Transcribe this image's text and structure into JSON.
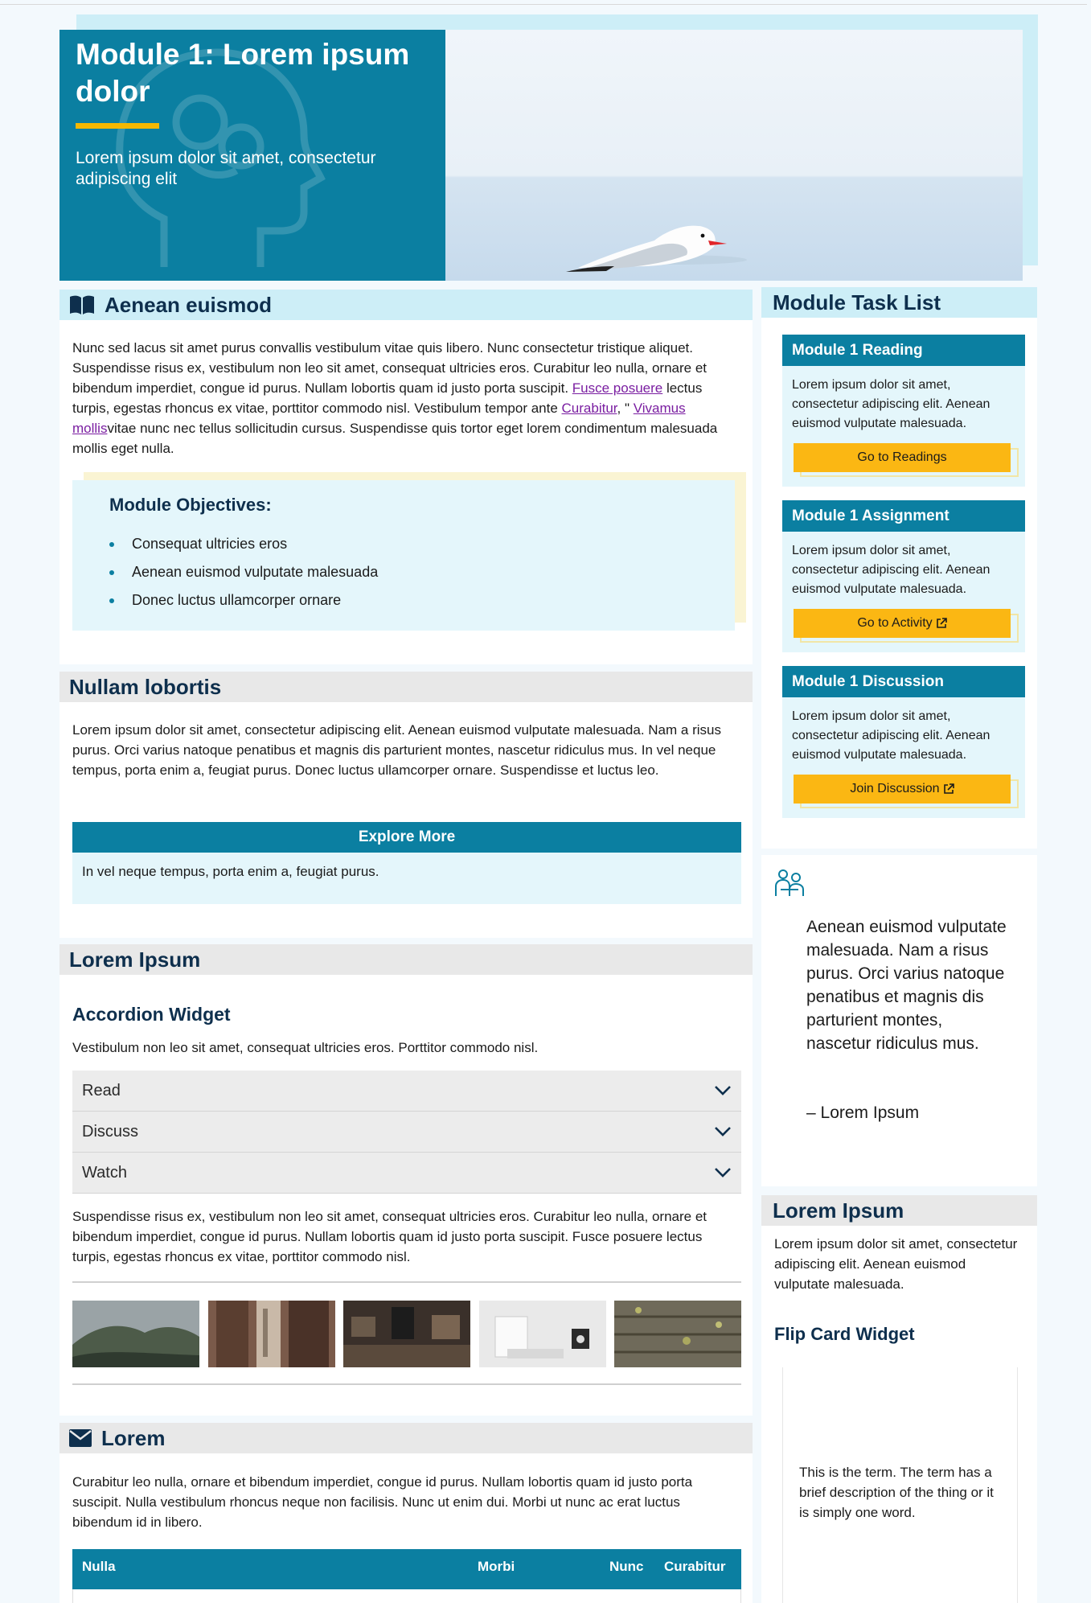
{
  "banner": {
    "title": "Module 1: Lorem ipsum dolor",
    "subtitle": "Lorem ipsum dolor sit amet, consectetur adipiscing elit"
  },
  "section1": {
    "title": "Aenean euismod",
    "text_a": "Nunc sed lacus sit amet purus convallis vestibulum vitae quis libero. Nunc consectetur tristique aliquet. Suspendisse risus ex, vestibulum non leo sit amet, consequat ultricies eros. Curabitur leo nulla, ornare et bibendum imperdiet, congue id purus. Nullam lobortis quam id justo porta suscipit. ",
    "link1": "Fusce posuere",
    "text_b": " lectus turpis, egestas rhoncus ex vitae, porttitor commodo nisl. Vestibulum tempor ante ",
    "link2": "Curabitur",
    "text_c": ", \" ",
    "link3": "Vivamus mollis",
    "text_d": "vitae nunc nec tellus sollicitudin cursus. Suspendisse quis tortor eget lorem condimentum malesuada mollis eget nulla.",
    "objectives_title": "Module Objectives:",
    "objectives": [
      "Consequat ultricies eros",
      "Aenean euismod vulputate malesuada",
      "Donec luctus ullamcorper ornare"
    ]
  },
  "section2": {
    "title": "Nullam lobortis",
    "text": "Lorem ipsum dolor sit amet, consectetur adipiscing elit. Aenean euismod vulputate malesuada. Nam a risus purus. Orci varius natoque penatibus et magnis dis parturient montes, nascetur ridiculus mus. In vel neque tempus, porta enim a, feugiat purus. Donec luctus ullamcorper ornare. Suspendisse et luctus leo.",
    "explore_label": "Explore More",
    "explore_text": "In vel neque tempus, porta enim a, feugiat purus."
  },
  "section3": {
    "title": "Lorem Ipsum",
    "accordion_title": "Accordion Widget",
    "accordion_intro": "Vestibulum non leo sit amet, consequat ultricies eros. Porttitor commodo nisl.",
    "accordion_items": [
      "Read",
      "Discuss",
      "Watch"
    ],
    "text": "Suspendisse risus ex, vestibulum non leo sit amet, consequat ultricies eros. Curabitur leo nulla, ornare et bibendum imperdiet, congue id purus. Nullam lobortis quam id justo porta suscipit. Fusce posuere lectus turpis, egestas rhoncus ex vitae, porttitor commodo nisl."
  },
  "section4": {
    "title": "Lorem",
    "text": "Curabitur leo nulla, ornare et bibendum imperdiet, congue id purus. Nullam lobortis quam id justo porta suscipit. Nulla vestibulum rhoncus neque non facilisis. Nunc ut enim dui. Morbi ut nunc ac erat luctus bibendum id in libero.",
    "table_headers": [
      "Nulla",
      "Morbi",
      "Nunc",
      "Curabitur"
    ]
  },
  "sidebar": {
    "task_list_title": "Module Task List",
    "tasks": [
      {
        "title": "Module 1 Reading",
        "text": "Lorem ipsum dolor sit amet, consectetur adipiscing elit. Aenean euismod vulputate malesuada.",
        "button": "Go to Readings"
      },
      {
        "title": "Module 1 Assignment",
        "text": "Lorem ipsum dolor sit amet, consectetur adipiscing elit. Aenean euismod vulputate malesuada.",
        "button": "Go to Activity"
      },
      {
        "title": "Module 1 Discussion",
        "text": "Lorem ipsum dolor sit amet, consectetur adipiscing elit. Aenean euismod vulputate malesuada.",
        "button": "Join Discussion"
      }
    ],
    "quote": "Aenean euismod vulputate malesuada. Nam a risus purus. Orci varius natoque penatibus et magnis dis parturient montes, nascetur ridiculus mus.",
    "quote_author": "– Lorem Ipsum",
    "lorem_title": "Lorem Ipsum",
    "lorem_text": "Lorem ipsum dolor sit amet, consectetur adipiscing elit. Aenean euismod vulputate malesuada.",
    "flip_title": "Flip Card Widget",
    "flip_text": "This is the term. The term has a brief description of the thing or it is simply one word."
  },
  "colors": {
    "primary": "#0b7fa1",
    "accent": "#f5b800",
    "button": "#fbb713",
    "light_blue": "#cdeef7",
    "pale_blue": "#e4f6fb"
  }
}
